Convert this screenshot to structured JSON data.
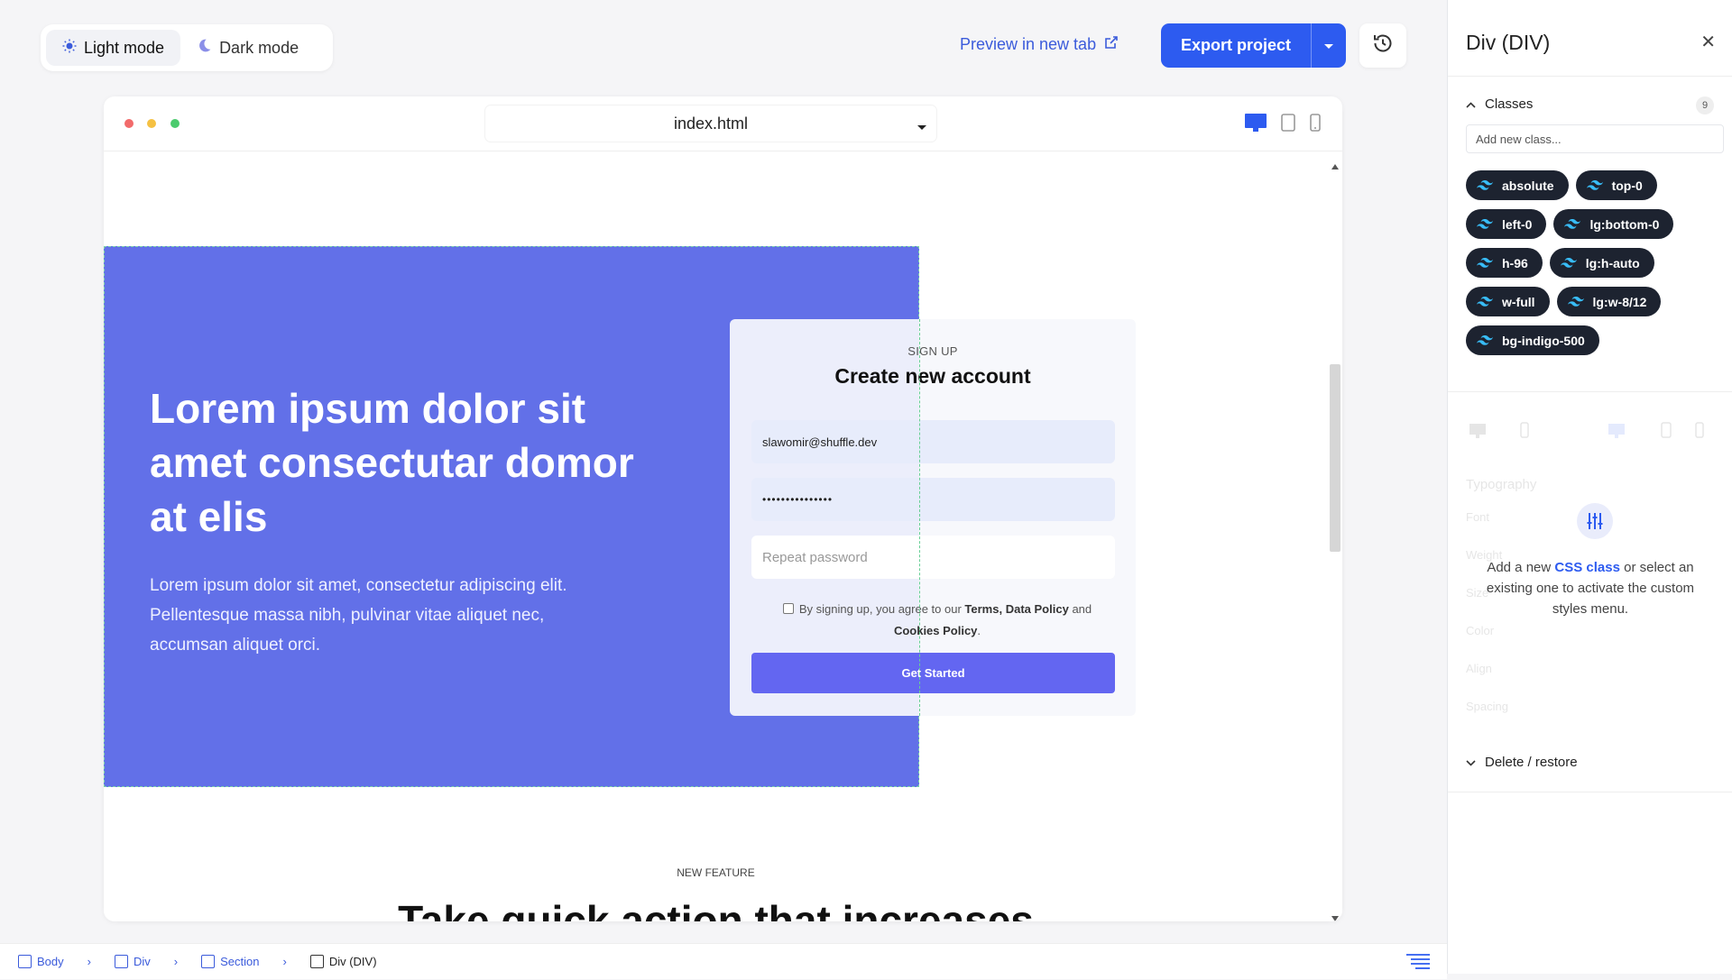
{
  "toolbar": {
    "light_mode": "Light mode",
    "dark_mode": "Dark mode",
    "preview": "Preview in new tab",
    "export": "Export project"
  },
  "browser": {
    "file": "index.html"
  },
  "page": {
    "hero_title": "Lorem ipsum dolor sit amet consectutar domor at elis",
    "hero_text": "Lorem ipsum dolor sit amet, consectetur adipiscing elit. Pellentesque massa nibh, pulvinar vitae aliquet nec, accumsan aliquet orci.",
    "form": {
      "eyebrow": "SIGN UP",
      "title": "Create new account",
      "email_value": "slawomir@shuffle.dev",
      "password_value": "•••••••••••••••",
      "repeat_placeholder": "Repeat password",
      "terms_prefix": "By signing up, you agree to our",
      "terms_link": "Terms,",
      "data_policy": "Data Policy",
      "and": "and",
      "cookies": "Cookies Policy",
      "period": ".",
      "cta": "Get Started"
    },
    "feature_eyebrow": "NEW FEATURE",
    "feature_title": "Take quick action that increases"
  },
  "breadcrumb": {
    "items": [
      "Body",
      "Div",
      "Section",
      "Div (DIV)"
    ]
  },
  "panel": {
    "title": "Div (DIV)",
    "classes_label": "Classes",
    "classes_count": "9",
    "class_input_placeholder": "Add new class...",
    "classes": [
      "absolute",
      "top-0",
      "left-0",
      "lg:bottom-0",
      "h-96",
      "lg:h-auto",
      "w-full",
      "lg:w-8/12",
      "bg-indigo-500"
    ],
    "typography_label": "Typography",
    "font_label": "Font",
    "weight_label": "Weight",
    "size_label": "Size",
    "color_label": "Color",
    "align_label": "Align",
    "spacing_label": "Spacing",
    "hint_prefix": "Add a new",
    "hint_bold": "CSS class",
    "hint_suffix": "or select an existing one to activate the custom styles menu.",
    "delete_label": "Delete / restore"
  },
  "colors": {
    "accent": "#2d5bf0",
    "hero_bg": "#6270e8",
    "cta_bg": "#6366f1",
    "chip_bg": "#1d2330"
  }
}
